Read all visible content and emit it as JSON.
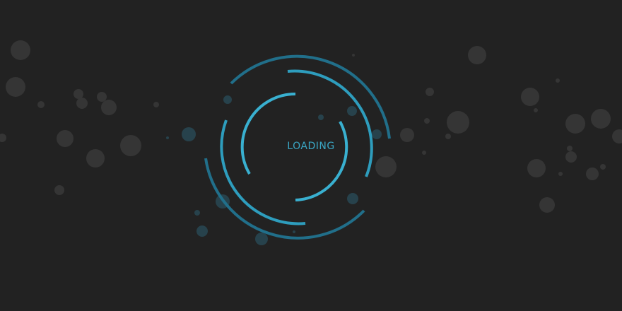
{
  "loader": {
    "label": "LOADING",
    "icon": "spinner-rings-icon"
  },
  "colors": {
    "background": "#222222",
    "bubble": "#3a3a3a",
    "bubble_teal": "#2a4a55",
    "ring_inner": "#39b0d0",
    "ring_mid": "#2e9dbd",
    "ring_outer": "#216f8a"
  }
}
